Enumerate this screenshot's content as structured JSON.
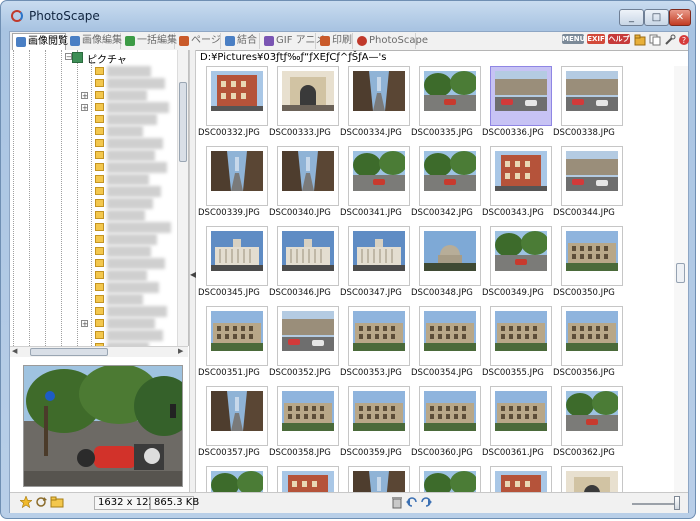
{
  "window": {
    "title": "PhotoScape",
    "min_label": "_",
    "max_label": "□",
    "close_label": "✕"
  },
  "tabs": [
    {
      "label": "画像閲覧",
      "icon": "viewer-icon",
      "color": "#4a7fc4",
      "active": true
    },
    {
      "label": "画像編集",
      "icon": "editor-icon",
      "color": "#4a7fc4",
      "active": false
    },
    {
      "label": "一括編集",
      "icon": "batch-icon",
      "color": "#3c9b46",
      "active": false
    },
    {
      "label": "ページ",
      "icon": "page-icon",
      "color": "#c95a2a",
      "active": false
    },
    {
      "label": "結合",
      "icon": "combine-icon",
      "color": "#4a7fc4",
      "active": false
    },
    {
      "label": "GIF アニメ",
      "icon": "gif-icon",
      "color": "#7a55b3",
      "active": false
    },
    {
      "label": "印刷",
      "icon": "print-icon",
      "color": "#c95a2a",
      "active": false
    },
    {
      "label": "PhotoScape",
      "icon": "photoscape-icon",
      "color": "#c0392b",
      "active": false
    }
  ],
  "toolbar": {
    "menu_label": "MENU",
    "exif_label": "EXIF",
    "help_label": "ヘルプ",
    "colors": {
      "menu": "#7c8a98",
      "exif": "#d24a3a",
      "help": "#c63a3a"
    }
  },
  "tree": {
    "root_label": "ピクチャ"
  },
  "path": "D:¥Pictures¥03ƒtƒ‰ƒ“ƒXEƒCƒ^ƒŠƒA—'s",
  "thumbnails": [
    {
      "name": "DSC00332.JPG",
      "scene": "facade",
      "selected": false
    },
    {
      "name": "DSC00333.JPG",
      "scene": "arch",
      "selected": false
    },
    {
      "name": "DSC00334.JPG",
      "scene": "street",
      "selected": false
    },
    {
      "name": "DSC00335.JPG",
      "scene": "park",
      "selected": false
    },
    {
      "name": "DSC00336.JPG",
      "scene": "traffic",
      "selected": true
    },
    {
      "name": "DSC00338.JPG",
      "scene": "traffic",
      "selected": false
    },
    {
      "name": "DSC00339.JPG",
      "scene": "street",
      "selected": false
    },
    {
      "name": "DSC00340.JPG",
      "scene": "street",
      "selected": false
    },
    {
      "name": "DSC00341.JPG",
      "scene": "park",
      "selected": false
    },
    {
      "name": "DSC00342.JPG",
      "scene": "park",
      "selected": false
    },
    {
      "name": "DSC00343.JPG",
      "scene": "facade",
      "selected": false
    },
    {
      "name": "DSC00344.JPG",
      "scene": "traffic",
      "selected": false
    },
    {
      "name": "DSC00345.JPG",
      "scene": "monument",
      "selected": false
    },
    {
      "name": "DSC00346.JPG",
      "scene": "monument",
      "selected": false
    },
    {
      "name": "DSC00347.JPG",
      "scene": "monument",
      "selected": false
    },
    {
      "name": "DSC00348.JPG",
      "scene": "dome",
      "selected": false
    },
    {
      "name": "DSC00349.JPG",
      "scene": "park",
      "selected": false
    },
    {
      "name": "DSC00350.JPG",
      "scene": "colosseum",
      "selected": false
    },
    {
      "name": "DSC00351.JPG",
      "scene": "colosseum",
      "selected": false
    },
    {
      "name": "DSC00352.JPG",
      "scene": "traffic",
      "selected": false
    },
    {
      "name": "DSC00353.JPG",
      "scene": "colosseum",
      "selected": false
    },
    {
      "name": "DSC00354.JPG",
      "scene": "colosseum",
      "selected": false
    },
    {
      "name": "DSC00355.JPG",
      "scene": "colosseum",
      "selected": false
    },
    {
      "name": "DSC00356.JPG",
      "scene": "colosseum",
      "selected": false
    },
    {
      "name": "DSC00357.JPG",
      "scene": "street",
      "selected": false
    },
    {
      "name": "DSC00358.JPG",
      "scene": "colosseum",
      "selected": false
    },
    {
      "name": "DSC00359.JPG",
      "scene": "colosseum",
      "selected": false
    },
    {
      "name": "DSC00360.JPG",
      "scene": "colosseum",
      "selected": false
    },
    {
      "name": "DSC00361.JPG",
      "scene": "colosseum",
      "selected": false
    },
    {
      "name": "DSC00362.JPG",
      "scene": "park",
      "selected": false
    },
    {
      "name": "",
      "scene": "park",
      "selected": false
    },
    {
      "name": "",
      "scene": "facade",
      "selected": false
    },
    {
      "name": "",
      "scene": "street",
      "selected": false
    },
    {
      "name": "",
      "scene": "park",
      "selected": false
    },
    {
      "name": "",
      "scene": "facade",
      "selected": false
    },
    {
      "name": "",
      "scene": "arch",
      "selected": false
    }
  ],
  "status": {
    "dimensions": "1632 x 1224",
    "filesize": "865.3 KB"
  }
}
